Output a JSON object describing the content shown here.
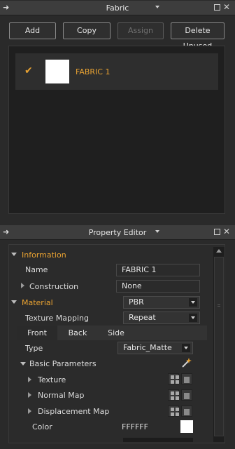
{
  "fabric_panel": {
    "title": "Fabric",
    "buttons": {
      "add": "Add",
      "copy": "Copy",
      "assign": "Assign",
      "delete_unused": "Delete Unused"
    },
    "materials": [
      {
        "name": "FABRIC 1",
        "checked": true,
        "swatch_color": "#FFFFFF"
      }
    ]
  },
  "property_editor": {
    "title": "Property Editor",
    "information": {
      "header": "Information",
      "name_label": "Name",
      "name_value": "FABRIC 1",
      "construction_label": "Construction",
      "construction_value": "None"
    },
    "material": {
      "header": "Material",
      "type_value": "PBR",
      "texture_mapping_label": "Texture Mapping",
      "texture_mapping_value": "Repeat",
      "tabs": [
        "Front",
        "Back",
        "Side"
      ],
      "type_label": "Type",
      "type_select_value": "Fabric_Matte",
      "basic_parameters_label": "Basic Parameters",
      "texture_label": "Texture",
      "normal_map_label": "Normal Map",
      "displacement_map_label": "Displacement Map",
      "color_label": "Color",
      "color_value": "FFFFFF"
    }
  },
  "colors": {
    "accent": "#E8A232",
    "background": "#2A2A2A",
    "titlebar": "#3D3D3D"
  }
}
